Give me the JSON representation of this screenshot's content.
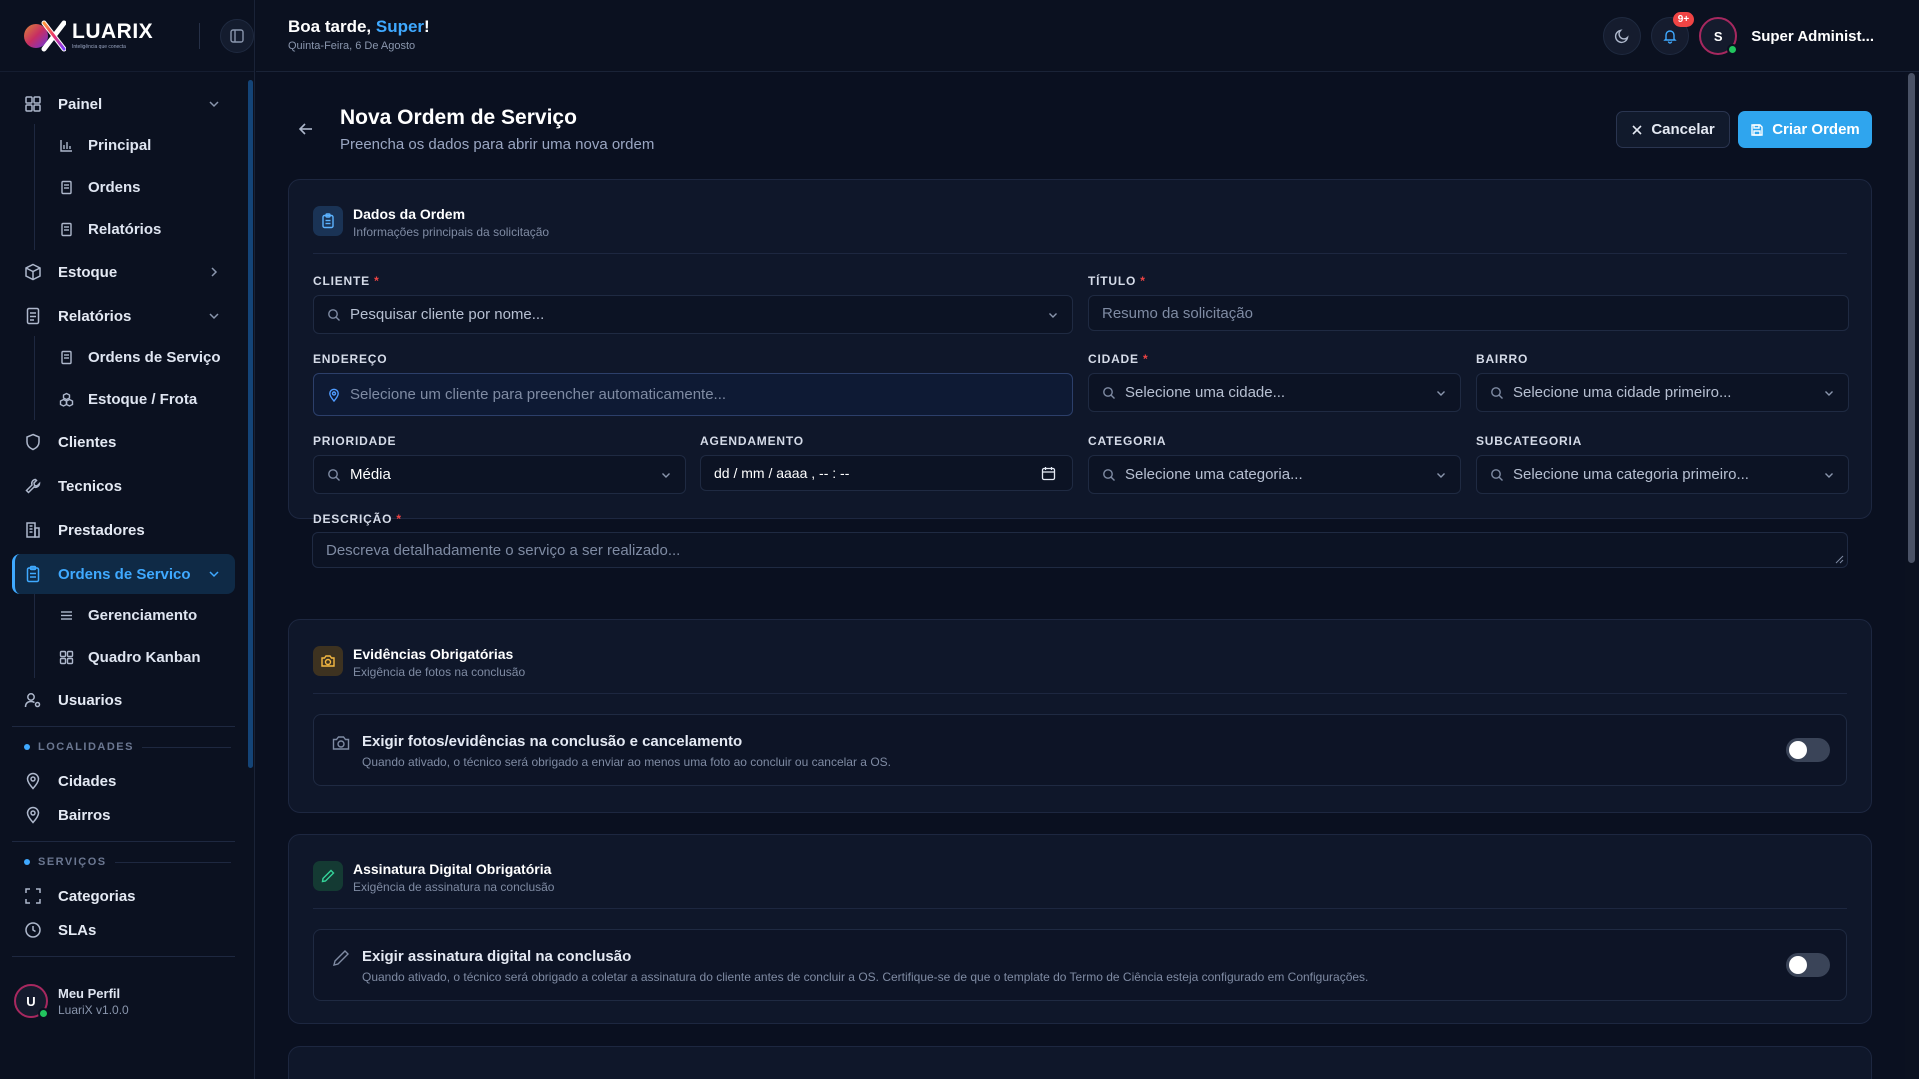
{
  "brand": {
    "name": "LUARIX",
    "tagline": "Inteligência que conecta"
  },
  "sidebar": {
    "items": [
      {
        "label": "Painel"
      },
      {
        "label": "Principal"
      },
      {
        "label": "Ordens"
      },
      {
        "label": "Relatórios"
      },
      {
        "label": "Estoque"
      },
      {
        "label": "Relatórios"
      },
      {
        "label": "Ordens de Serviço"
      },
      {
        "label": "Estoque / Frota"
      },
      {
        "label": "Clientes"
      },
      {
        "label": "Tecnicos"
      },
      {
        "label": "Prestadores"
      },
      {
        "label": "Ordens de Servico"
      },
      {
        "label": "Gerenciamento"
      },
      {
        "label": "Quadro Kanban"
      },
      {
        "label": "Usuarios"
      },
      {
        "label": "Cidades"
      },
      {
        "label": "Bairros"
      },
      {
        "label": "Categorias"
      },
      {
        "label": "SLAs"
      }
    ],
    "sections": {
      "localidades": "LOCALIDADES",
      "servicos": "SERVIÇOS"
    },
    "profile": {
      "initial": "U",
      "name": "Meu Perfil",
      "version": "LuariX v1.0.0"
    }
  },
  "topbar": {
    "greeting_prefix": "Boa tarde, ",
    "greeting_name": "Super",
    "greeting_suffix": "!",
    "date": "Quinta-Feira, 6 De Agosto",
    "notifications_badge": "9+",
    "user_initial": "S",
    "user_name": "Super Administ..."
  },
  "page": {
    "title": "Nova Ordem de Serviço",
    "subtitle": "Preencha os dados para abrir uma nova ordem",
    "cancel_label": "Cancelar",
    "create_label": "Criar Ordem"
  },
  "order_card": {
    "title": "Dados da Ordem",
    "description": "Informações principais da solicitação",
    "fields": {
      "cliente": {
        "label": "CLIENTE",
        "placeholder": "Pesquisar cliente por nome..."
      },
      "titulo": {
        "label": "TÍTULO",
        "placeholder": "Resumo da solicitação"
      },
      "endereco": {
        "label": "ENDEREÇO",
        "placeholder": "Selecione um cliente para preencher automaticamente..."
      },
      "cidade": {
        "label": "CIDADE",
        "placeholder": "Selecione uma cidade..."
      },
      "bairro": {
        "label": "BAIRRO",
        "placeholder": "Selecione uma cidade primeiro..."
      },
      "prioridade": {
        "label": "PRIORIDADE",
        "value": "Média"
      },
      "agendamento": {
        "label": "AGENDAMENTO",
        "placeholder": "dd / mm / aaaa ,  -- : --"
      },
      "categoria": {
        "label": "CATEGORIA",
        "placeholder": "Selecione uma categoria..."
      },
      "subcategoria": {
        "label": "SUBCATEGORIA",
        "placeholder": "Selecione uma categoria primeiro..."
      },
      "descricao": {
        "label": "DESCRIÇÃO",
        "placeholder": "Descreva detalhadamente o serviço a ser realizado..."
      }
    },
    "required_mark": "*"
  },
  "evidence_card": {
    "title": "Evidências Obrigatórias",
    "description": "Exigência de fotos na conclusão",
    "option_title": "Exigir fotos/evidências na conclusão e cancelamento",
    "option_desc": "Quando ativado, o técnico será obrigado a enviar ao menos uma foto ao concluir ou cancelar a OS.",
    "enabled": false
  },
  "signature_card": {
    "title": "Assinatura Digital Obrigatória",
    "description": "Exigência de assinatura na conclusão",
    "option_title": "Exigir assinatura digital na conclusão",
    "option_desc": "Quando ativado, o técnico será obrigado a coletar a assinatura do cliente antes de concluir a OS. Certifique-se de que o template do Termo de Ciência esteja configurado em Configurações.",
    "enabled": false
  },
  "colors": {
    "accent": "#3fa9ff",
    "primary_button": "#2fa5ee",
    "required": "#ef4444",
    "online": "#22c55e"
  }
}
